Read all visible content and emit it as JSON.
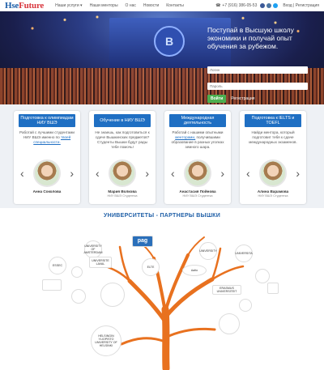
{
  "header": {
    "logo_left": "Hse",
    "logo_right": "Future",
    "nav": [
      "Наши услуги ▾",
      "Наши менторы",
      "О нас",
      "Новости",
      "Контакты"
    ],
    "phone": "+7 (916) 386-05-53",
    "login": "Вход | Регистрация",
    "social_icons": [
      "facebook-icon",
      "vk-icon",
      "twitter-icon"
    ]
  },
  "hero": {
    "headline": "Поступай в Высшую школу экономики и получай опыт обучения за рубежом.",
    "name_placeholder": "Логин",
    "password_placeholder": "Пароль",
    "login_button": "Войти",
    "register_link": "Регистрация",
    "emblem_letter": "B"
  },
  "cards": [
    {
      "title": "Подготовка к олимпиадам НИУ ВШЭ",
      "body": "Работай с лучшими студентами НИУ ВШЭ именно по",
      "link": "твоей специальности.",
      "person": "Анна Соколова",
      "role": ""
    },
    {
      "title": "Обучение в НИУ ВШЭ",
      "body": "Не знаешь, как подготовиться к сдаче Вышкинских предметов? Студенты Вышки будут рады тебе помочь!",
      "link": "",
      "person": "Мария Волкова",
      "role": "НИУ ВШЭ Студентка"
    },
    {
      "title": "Международная деятельность",
      "body": "Работай с нашими опытными",
      "link": "менторами,",
      "body2": "получившими образование в разных уголках земного шара.",
      "person": "Анастасия Пойнова",
      "role": "НИУ ВШЭ Студентка"
    },
    {
      "title": "Подготовка к IELTS и TOEFL",
      "body": "Найди ментора, который подготовит тебя к сдаче международных экзаменов.",
      "link": "",
      "person": "Алина Варамова",
      "role": "НИУ ВШЭ Студентка"
    }
  ],
  "partners": {
    "title": "УНИВЕРСИТЕТЫ - ПАРТНЕРЫ ВЫШКИ",
    "logos": [
      "ESSEC",
      "UNIVERSITY OF AMSTERDAM",
      "pag",
      "UNIVERSITE LAVAL",
      "ELTE",
      "UNIVERSITY",
      "UNIVERSITA",
      "Aalto",
      "ERASMUS UNIVERSITEIT",
      "HELSINGIN YLIOPISTO UNIVERSITY OF HELSINKI"
    ]
  },
  "colors": {
    "brand_blue": "#1f6fc3",
    "brand_red": "#d9363e",
    "tree": "#e8711f",
    "go_green": "#4caf50"
  }
}
